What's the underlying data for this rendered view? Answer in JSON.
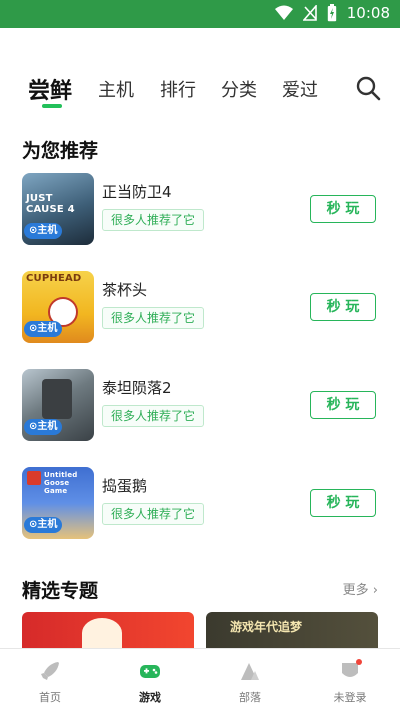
{
  "status_bar": {
    "time": "10:08",
    "wifi_icon": "wifi-icon",
    "signal_icon": "signal-off-icon",
    "battery_icon": "battery-charging-icon",
    "background": "#2f9a48"
  },
  "tabs": [
    {
      "label": "尝鲜",
      "active": true
    },
    {
      "label": "主机",
      "active": false
    },
    {
      "label": "排行",
      "active": false
    },
    {
      "label": "分类",
      "active": false
    },
    {
      "label": "爱过",
      "active": false
    }
  ],
  "search_icon": "search-icon",
  "recommend": {
    "title": "为您推荐",
    "items": [
      {
        "name": "正当防卫4",
        "tag": "很多人推荐了它",
        "button": "秒 玩",
        "badge": "主机",
        "cover_text": "JUST CAUSE 4"
      },
      {
        "name": "茶杯头",
        "tag": "很多人推荐了它",
        "button": "秒 玩",
        "badge": "主机",
        "cover_text": "CUPHEAD"
      },
      {
        "name": "泰坦陨落2",
        "tag": "很多人推荐了它",
        "button": "秒 玩",
        "badge": "主机",
        "cover_text": ""
      },
      {
        "name": "捣蛋鹅",
        "tag": "很多人推荐了它",
        "button": "秒 玩",
        "badge": "主机",
        "cover_text": "Untitled Goose Game"
      }
    ]
  },
  "featured": {
    "title": "精选专题",
    "more_label": "更多",
    "banners": [
      {
        "text": ""
      },
      {
        "text": "游戏年代追梦"
      }
    ]
  },
  "bottom_nav": [
    {
      "label": "首页",
      "icon": "rocket-icon",
      "active": false
    },
    {
      "label": "游戏",
      "icon": "gamepad-icon",
      "active": true
    },
    {
      "label": "部落",
      "icon": "mountain-icon",
      "active": false
    },
    {
      "label": "未登录",
      "icon": "user-badge-icon",
      "active": false
    }
  ],
  "colors": {
    "accent": "#27b55a",
    "tag_text": "#2fae57",
    "badge": "#2a7ad8"
  }
}
